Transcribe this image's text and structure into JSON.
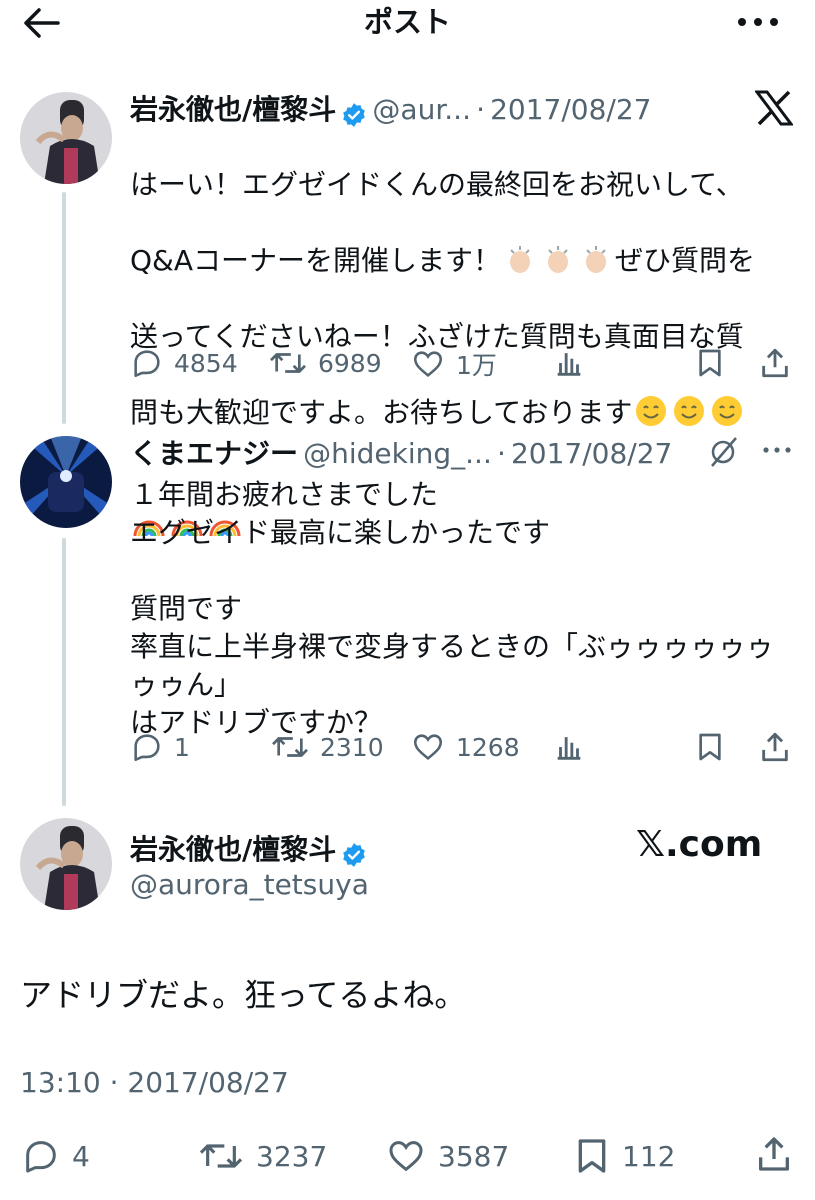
{
  "header": {
    "title": "ポスト"
  },
  "post1": {
    "name": "岩永徹也/檀黎斗",
    "handle": "@aur...",
    "dot": "·",
    "date": "2017/08/27",
    "text_line1": "はーい！エグゼイドくんの最終回をお祝いして、",
    "text_line2a": "Q&Aコーナーを開催します！",
    "text_line2b": "ぜひ質問を",
    "text_line3": "送ってくださいねー！ふざけた質問も真面目な質",
    "text_line4": "問も大歓迎ですよ。お待ちしております",
    "replies": "4854",
    "reposts": "6989",
    "likes": "1万"
  },
  "post2": {
    "name": "くまエナジー",
    "handle": "@hideking_...",
    "dot": "·",
    "date": "2017/08/27",
    "text": "１年間お疲れさまでした\nエグゼイド最高に楽しかったです\n\n質問です\n率直に上半身裸で変身するときの「ぶゥゥゥゥゥゥゥゥん」\nはアドリブですか？",
    "replies": "1",
    "reposts": "2310",
    "likes": "1268"
  },
  "post3": {
    "name": "岩永徹也/檀黎斗",
    "handle": "@aurora_tetsuya",
    "watermark": "𝕏.com",
    "text": "アドリブだよ。狂ってるよね。",
    "time": "13:10 · 2017/08/27",
    "replies": "4",
    "reposts": "3237",
    "likes": "3587",
    "bookmarks": "112"
  },
  "colors": {
    "verified": "#1d9bf0",
    "secondary": "#536471",
    "thread": "#cfd9de"
  }
}
